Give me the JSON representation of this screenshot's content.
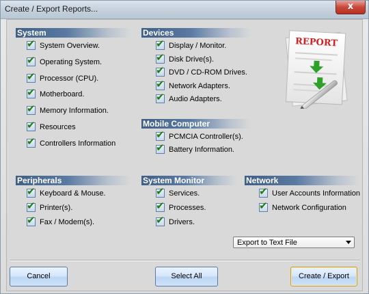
{
  "window": {
    "title": "Create / Export Reports...",
    "close_glyph": "x"
  },
  "groups": {
    "system": {
      "header": "System",
      "items": [
        {
          "label": "System Overview.",
          "checked": true
        },
        {
          "label": "Operating System.",
          "checked": true
        },
        {
          "label": "Processor (CPU).",
          "checked": true
        },
        {
          "label": "Motherboard.",
          "checked": true
        },
        {
          "label": "Memory Information.",
          "checked": true
        },
        {
          "label": "Resources",
          "checked": true
        },
        {
          "label": "Controllers Information",
          "checked": true
        }
      ]
    },
    "devices": {
      "header": "Devices",
      "items": [
        {
          "label": "Display / Monitor.",
          "checked": true
        },
        {
          "label": "Disk Drive(s).",
          "checked": true
        },
        {
          "label": "DVD / CD-ROM Drives.",
          "checked": true
        },
        {
          "label": "Network Adapters.",
          "checked": true
        },
        {
          "label": "Audio Adapters.",
          "checked": true
        }
      ]
    },
    "mobile": {
      "header": "Mobile Computer",
      "items": [
        {
          "label": "PCMCIA Controller(s).",
          "checked": true
        },
        {
          "label": "Battery Information.",
          "checked": true
        }
      ]
    },
    "peripherals": {
      "header": "Peripherals",
      "items": [
        {
          "label": "Keyboard & Mouse.",
          "checked": true
        },
        {
          "label": "Printer(s).",
          "checked": true
        },
        {
          "label": "Fax / Modem(s).",
          "checked": true
        }
      ]
    },
    "monitor": {
      "header": "System Monitor",
      "items": [
        {
          "label": "Services.",
          "checked": true
        },
        {
          "label": "Processes.",
          "checked": true
        },
        {
          "label": "Drivers.",
          "checked": true
        }
      ]
    },
    "network": {
      "header": "Network",
      "items": [
        {
          "label": "User Accounts Information",
          "checked": true
        },
        {
          "label": "Network Configuration",
          "checked": true
        }
      ]
    }
  },
  "report_image": {
    "label": "REPORT",
    "icon": "report-document-icon"
  },
  "export": {
    "selected": "Export to Text File"
  },
  "buttons": {
    "cancel": "Cancel",
    "select_all": "Select All",
    "create_export": "Create / Export"
  },
  "colors": {
    "group_header": "#3f5f86",
    "check": "#1f7a10",
    "button_border": "#5a7aa0"
  }
}
